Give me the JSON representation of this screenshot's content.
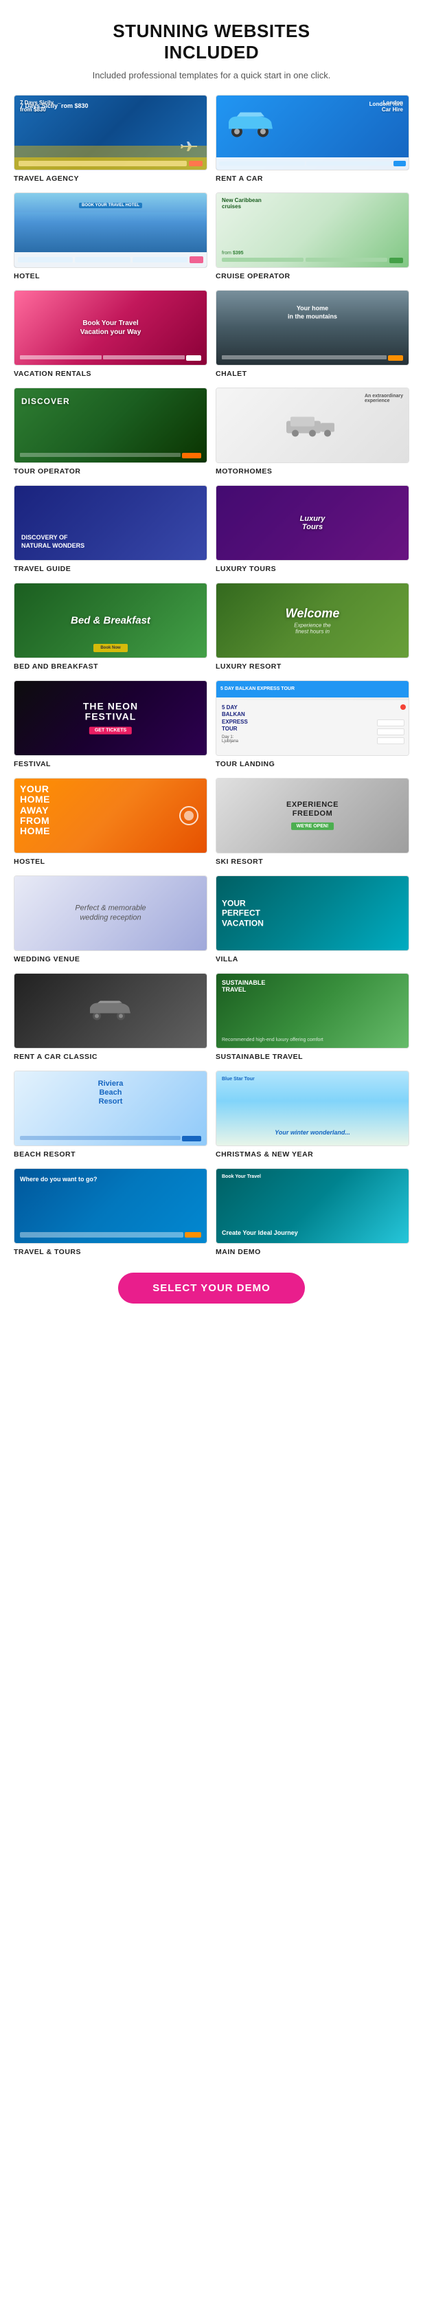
{
  "header": {
    "title_line1": "STUNNING WEBSITES",
    "title_line2": "INCLUDED",
    "subtitle": "Included professional templates for a quick start in one click."
  },
  "grid_items": [
    {
      "id": "travel-agency",
      "label": "TRAVEL AGENCY",
      "theme": "blue-gradient"
    },
    {
      "id": "rent-car",
      "label": "RENT A CAR",
      "theme": "blue"
    },
    {
      "id": "hotel",
      "label": "HOTEL",
      "theme": "ocean"
    },
    {
      "id": "cruise-operator",
      "label": "CRUISE OPERATOR",
      "theme": "green-light"
    },
    {
      "id": "vacation-rentals",
      "label": "VACATION RENTALS",
      "theme": "pink"
    },
    {
      "id": "chalet",
      "label": "CHALET",
      "theme": "grey-dark"
    },
    {
      "id": "tour-operator",
      "label": "TOUR OPERATOR",
      "theme": "dark-green"
    },
    {
      "id": "motorhomes",
      "label": "MOTORHOMES",
      "theme": "light-grey"
    },
    {
      "id": "travel-guide",
      "label": "TRAVEL GUIDE",
      "theme": "dark-blue"
    },
    {
      "id": "luxury-tours",
      "label": "LUXURY TOURS",
      "theme": "purple"
    },
    {
      "id": "bed-and-breakfast",
      "label": "BED AND BREAKFAST",
      "theme": "green-medium"
    },
    {
      "id": "luxury-resort",
      "label": "LUXURY RESORT",
      "theme": "dark-green2"
    },
    {
      "id": "festival",
      "label": "FESTIVAL",
      "theme": "black-purple"
    },
    {
      "id": "tour-landing",
      "label": "TOUR LANDING",
      "theme": "white-blue"
    },
    {
      "id": "hostel",
      "label": "HOSTEL",
      "theme": "orange"
    },
    {
      "id": "ski-resort",
      "label": "SKI RESORT",
      "theme": "white-grey"
    },
    {
      "id": "wedding-venue",
      "label": "WEDDING VENUE",
      "theme": "lavender"
    },
    {
      "id": "villa",
      "label": "VILLA",
      "theme": "teal"
    },
    {
      "id": "rent-car-classic",
      "label": "RENT A CAR CLASSIC",
      "theme": "dark"
    },
    {
      "id": "sustainable-travel",
      "label": "SUSTAINABLE TRAVEL",
      "theme": "green3"
    },
    {
      "id": "beach-resort",
      "label": "BEACH RESORT",
      "theme": "light-blue"
    },
    {
      "id": "christmas",
      "label": "CHRISTMAS & NEW YEAR",
      "theme": "sky-green"
    },
    {
      "id": "travel-tours",
      "label": "TRAVEL & TOURS",
      "theme": "blue-med"
    },
    {
      "id": "main-demo",
      "label": "MAIN DEMO",
      "theme": "teal-blue"
    }
  ],
  "select_button": "SELECT YOUR DEMO"
}
